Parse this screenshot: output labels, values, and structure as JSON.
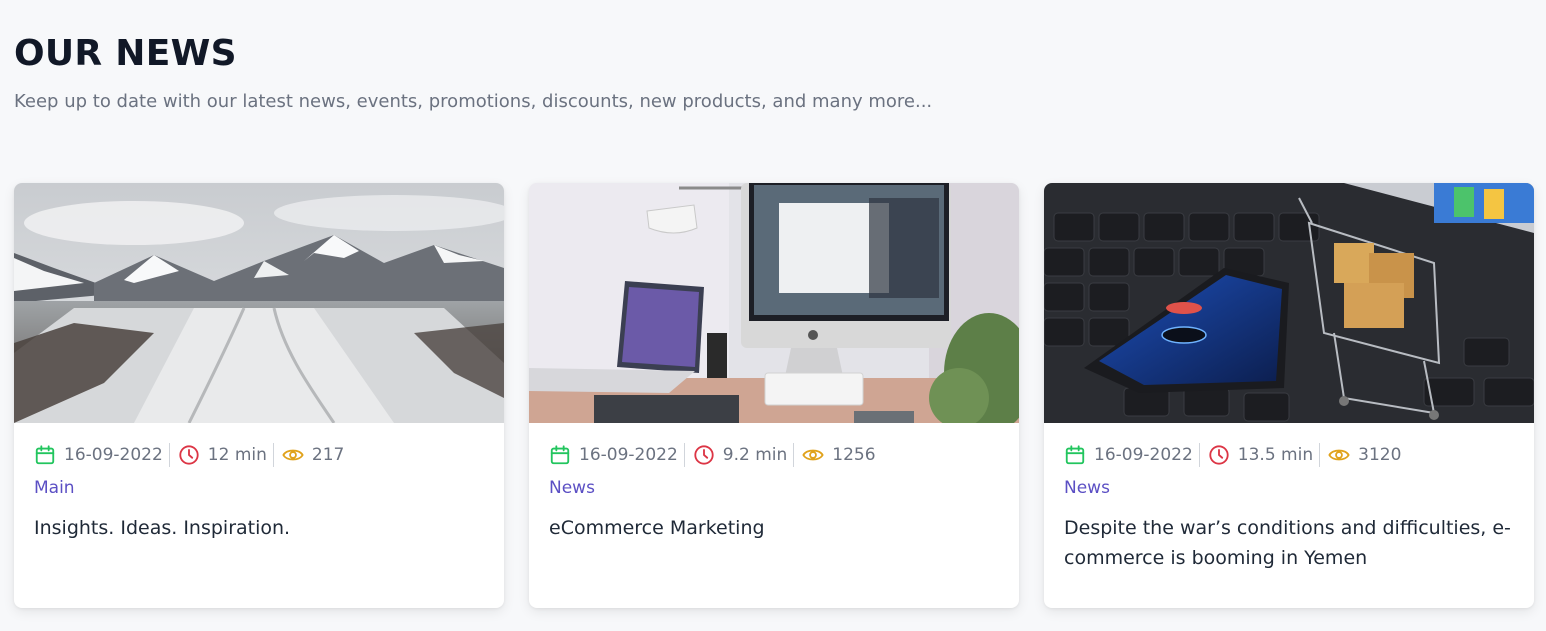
{
  "section": {
    "title": "OUR NEWS",
    "subtitle": "Keep up to date with our latest news, events, promotions, discounts, new products, and many more..."
  },
  "icons": {
    "date": "calendar-icon",
    "time": "clock-icon",
    "views": "eye-icon"
  },
  "colors": {
    "calendar": "#22c55e",
    "clock": "#dc3545",
    "eye": "#e0a21b",
    "category": "#5b4fc4"
  },
  "cards": [
    {
      "date": "16-09-2022",
      "read_time": "12 min",
      "views": "217",
      "category": "Main",
      "title": "Insights. Ideas. Inspiration."
    },
    {
      "date": "16-09-2022",
      "read_time": "9.2 min",
      "views": "1256",
      "category": "News",
      "title": "eCommerce Marketing"
    },
    {
      "date": "16-09-2022",
      "read_time": "13.5 min",
      "views": "3120",
      "category": "News",
      "title": "Despite the war’s conditions and difficulties, e-commerce is booming in Yemen"
    }
  ]
}
